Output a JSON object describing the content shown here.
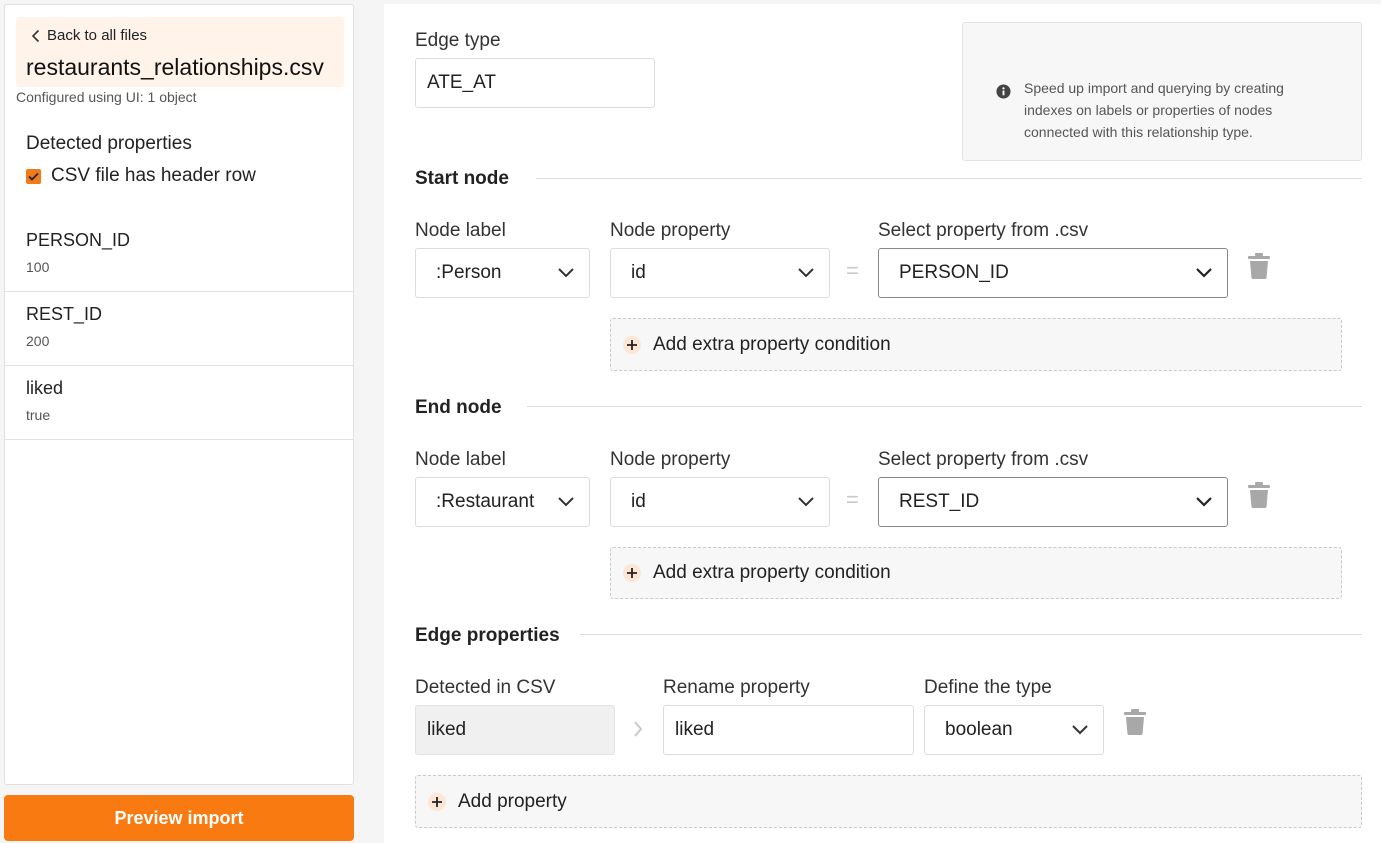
{
  "sidebar": {
    "back_label": "Back to all files",
    "file_name": "restaurants_relationships.csv",
    "config_text": "Configured using UI: 1 object",
    "detected_title": "Detected properties",
    "header_row_label": "CSV file has header row",
    "header_row_checked": true,
    "properties": [
      {
        "name": "PERSON_ID",
        "value": "100"
      },
      {
        "name": "REST_ID",
        "value": "200"
      },
      {
        "name": "liked",
        "value": "true"
      }
    ]
  },
  "preview_button": "Preview import",
  "edge": {
    "type_label": "Edge type",
    "type_value": "ATE_AT"
  },
  "info": {
    "text": "Speed up import and querying by creating indexes on labels or properties of nodes connected with this relationship type."
  },
  "start_node": {
    "title": "Start node",
    "node_label_label": "Node label",
    "node_label_value": ":Person",
    "node_property_label": "Node property",
    "node_property_value": "id",
    "equals": "=",
    "csv_property_label": "Select property from .csv",
    "csv_property_value": "PERSON_ID",
    "add_condition": "Add extra property condition"
  },
  "end_node": {
    "title": "End node",
    "node_label_label": "Node label",
    "node_label_value": ":Restaurant",
    "node_property_label": "Node property",
    "node_property_value": "id",
    "equals": "=",
    "csv_property_label": "Select property from .csv",
    "csv_property_value": "REST_ID",
    "add_condition": "Add extra property condition"
  },
  "edge_properties": {
    "title": "Edge properties",
    "detected_label": "Detected in CSV",
    "rename_label": "Rename property",
    "type_label": "Define the type",
    "row": {
      "detected": "liked",
      "rename": "liked",
      "type": "boolean"
    },
    "add_property": "Add property"
  },
  "colors": {
    "accent": "#f97a10",
    "header_bg": "#fff3ea"
  },
  "icons": {
    "back": "chevron-left-icon",
    "checkbox": "checkmark-icon",
    "select": "chevron-down-icon",
    "delete": "trash-icon",
    "add": "plus-icon",
    "info": "info-icon",
    "arrow": "chevron-right-icon"
  }
}
